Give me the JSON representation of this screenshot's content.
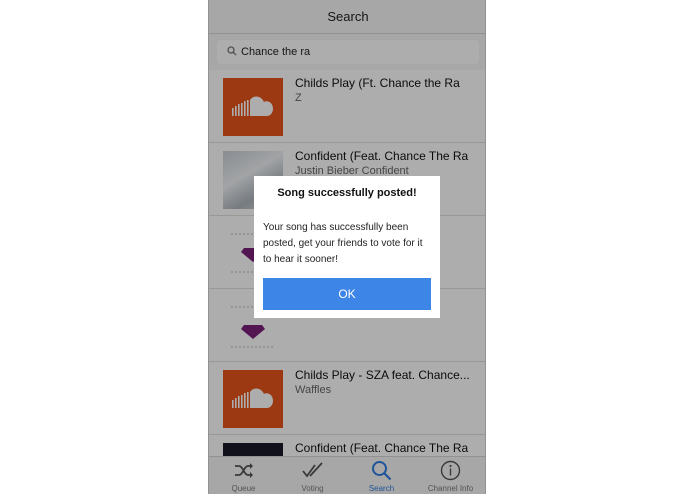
{
  "navbar": {
    "title": "Search"
  },
  "search": {
    "query": "Chance the ra"
  },
  "results": [
    {
      "title": "Childs Play (Ft. Chance the Ra",
      "subtitle": "Z",
      "art": "soundcloud-logo"
    },
    {
      "title": "Confident (Feat. Chance The Ra",
      "subtitle": "Justin Bieber Confident",
      "art": "snowy-bridge-photo"
    },
    {
      "title": "",
      "subtitle": "",
      "art": "diamond-icon"
    },
    {
      "title": "",
      "subtitle": "",
      "art": "diamond-icon"
    },
    {
      "title": "Childs Play - SZA feat. Chance...",
      "subtitle": "Waffles",
      "art": "soundcloud-logo"
    },
    {
      "title": "Confident (Feat. Chance The Ra",
      "subtitle": "",
      "art": "album-art-dark"
    }
  ],
  "tabs": [
    {
      "label": "Queue",
      "icon": "shuffle-icon"
    },
    {
      "label": "Voting",
      "icon": "double-check-icon"
    },
    {
      "label": "Search",
      "icon": "search-icon",
      "active": true
    },
    {
      "label": "Channel Info",
      "icon": "info-icon"
    }
  ],
  "dialog": {
    "title": "Song successfully posted!",
    "body": "Your song has successfully been posted, get your friends to vote for it to hear it sooner!",
    "ok_label": "OK"
  },
  "colors": {
    "accent": "#3d85e6",
    "soundcloud": "#e6541c",
    "diamond": "#7a1f7a"
  }
}
